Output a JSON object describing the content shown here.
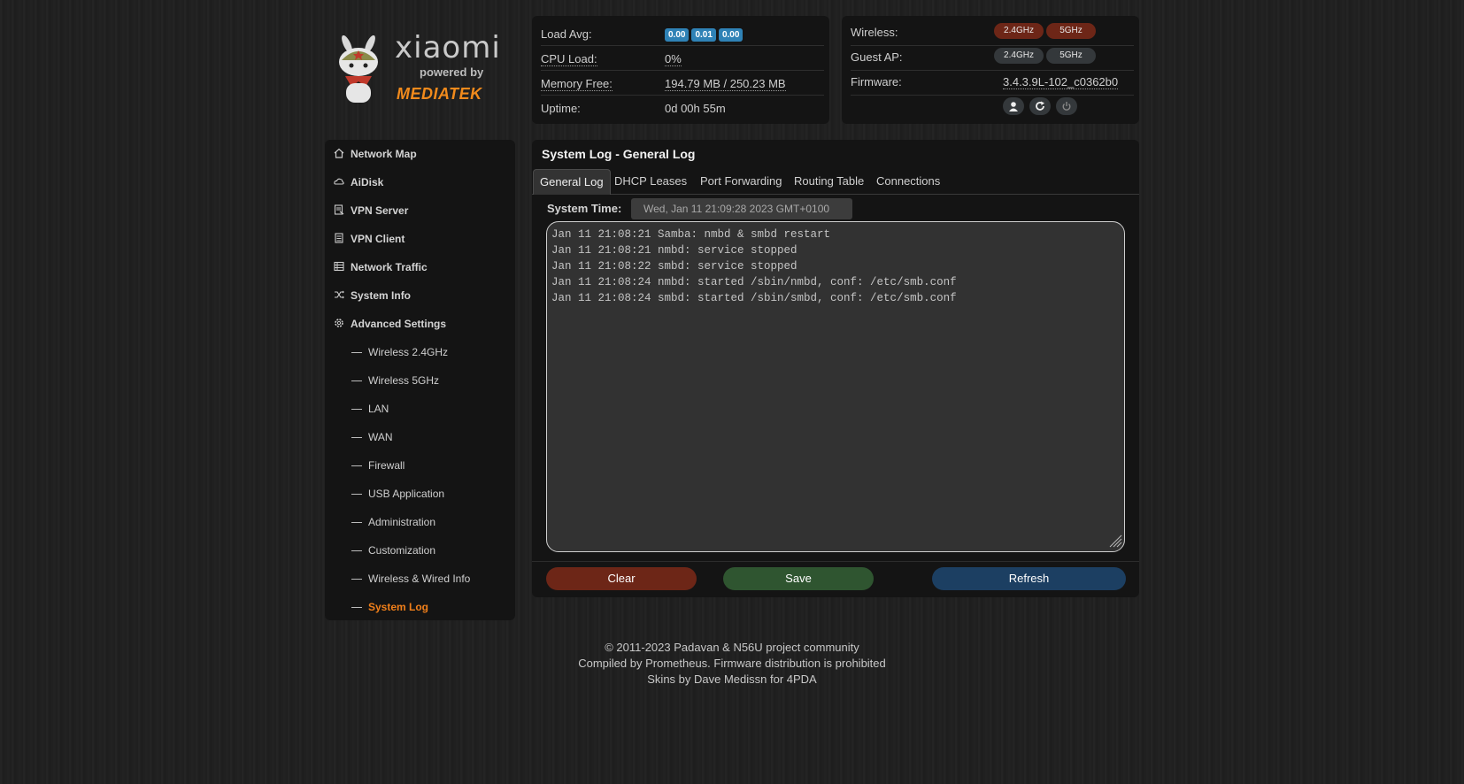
{
  "logo": {
    "brand": "xiaomi",
    "powered": "powered by",
    "partner": "MEDIATEK"
  },
  "status": {
    "load_avg_label": "Load Avg:",
    "load_avg": [
      "0.00",
      "0.01",
      "0.00"
    ],
    "cpu_label": "CPU Load:",
    "cpu_value": "0%",
    "mem_label": "Memory Free:",
    "mem_value": "194.79 MB / 250.23 MB",
    "uptime_label": "Uptime:",
    "uptime_value": "0d 00h 55m",
    "wireless_label": "Wireless:",
    "guest_label": "Guest AP:",
    "band_24": "2.4GHz",
    "band_5": "5GHz",
    "firmware_label": "Firmware:",
    "firmware_value": "3.4.3.9L-102_c0362b0"
  },
  "sidebar": {
    "items": [
      {
        "label": "Network Map",
        "icon": "home-icon"
      },
      {
        "label": "AiDisk",
        "icon": "cloud-icon"
      },
      {
        "label": "VPN Server",
        "icon": "vpn-server-icon"
      },
      {
        "label": "VPN Client",
        "icon": "vpn-client-icon"
      },
      {
        "label": "Network Traffic",
        "icon": "traffic-icon"
      },
      {
        "label": "System Info",
        "icon": "shuffle-icon"
      },
      {
        "label": "Advanced Settings",
        "icon": "gear-icon"
      }
    ],
    "subitems": [
      "Wireless 2.4GHz",
      "Wireless 5GHz",
      "LAN",
      "WAN",
      "Firewall",
      "USB Application",
      "Administration",
      "Customization",
      "Wireless & Wired Info",
      "System Log"
    ]
  },
  "main": {
    "title": "System Log - General Log",
    "tabs": [
      "General Log",
      "DHCP Leases",
      "Port Forwarding",
      "Routing Table",
      "Connections"
    ],
    "systime_label": "System Time:",
    "systime_value": "Wed, Jan 11 21:09:28 2023 GMT+0100",
    "log_text": "Jan 11 21:08:21 Samba: nmbd & smbd restart\nJan 11 21:08:21 nmbd: service stopped\nJan 11 21:08:22 smbd: service stopped\nJan 11 21:08:24 nmbd: started /sbin/nmbd, conf: /etc/smb.conf\nJan 11 21:08:24 smbd: started /sbin/smbd, conf: /etc/smb.conf",
    "buttons": {
      "clear": "Clear",
      "save": "Save",
      "refresh": "Refresh"
    }
  },
  "footer": [
    "© 2011-2023 Padavan & N56U project community",
    "Compiled by Prometheus. Firmware distribution is prohibited",
    "Skins by Dave Medissn for 4PDA"
  ],
  "colors": {
    "accent": "#f07f1a",
    "badge_blue": "#2f82b6",
    "clear": "#6d2617",
    "save": "#2f5530",
    "refresh": "#1c3f62"
  }
}
